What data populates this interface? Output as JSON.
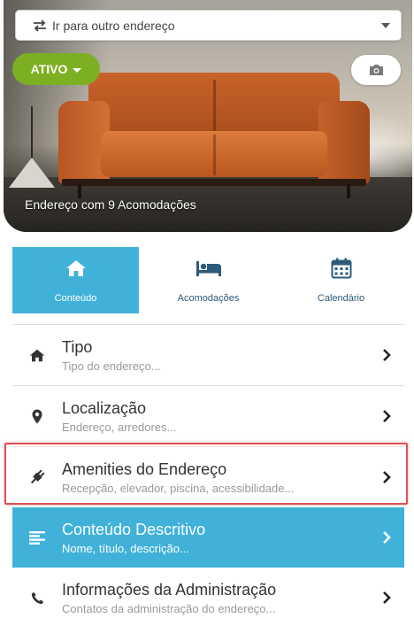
{
  "header": {
    "address_select": {
      "label": "Ir para outro endereço",
      "icon": "swap-arrows-icon"
    },
    "status": {
      "label": "ATIVO",
      "color": "#7cb022"
    },
    "camera_icon": "camera-icon",
    "caption": "Endereço com 9 Acomodações"
  },
  "tabs": [
    {
      "label": "Conteúdo",
      "icon": "home-icon",
      "active": true
    },
    {
      "label": "Acomodações",
      "icon": "bed-icon",
      "active": false
    },
    {
      "label": "Calendário",
      "icon": "calendar-icon",
      "active": false
    }
  ],
  "menu": {
    "items": [
      {
        "title": "Tipo",
        "subtitle": "Tipo do endereço...",
        "icon": "home-icon"
      },
      {
        "title": "Localização",
        "subtitle": "Endereço, arredores...",
        "icon": "map-pin-icon"
      },
      {
        "title": "Amenities do Endereço",
        "subtitle": "Recepção, elevador, piscina, acessibilidade...",
        "icon": "plug-icon",
        "highlighted": true
      },
      {
        "title": "Conteúdo Descritivo",
        "subtitle": "Nome, título, descrição...",
        "icon": "align-left-icon",
        "featured": true
      },
      {
        "title": "Informações da Administração",
        "subtitle": "Contatos da administração do endereço...",
        "icon": "phone-icon"
      }
    ]
  },
  "colors": {
    "accent": "#40b2d9",
    "highlight": "#e05256",
    "success": "#7cb022"
  }
}
